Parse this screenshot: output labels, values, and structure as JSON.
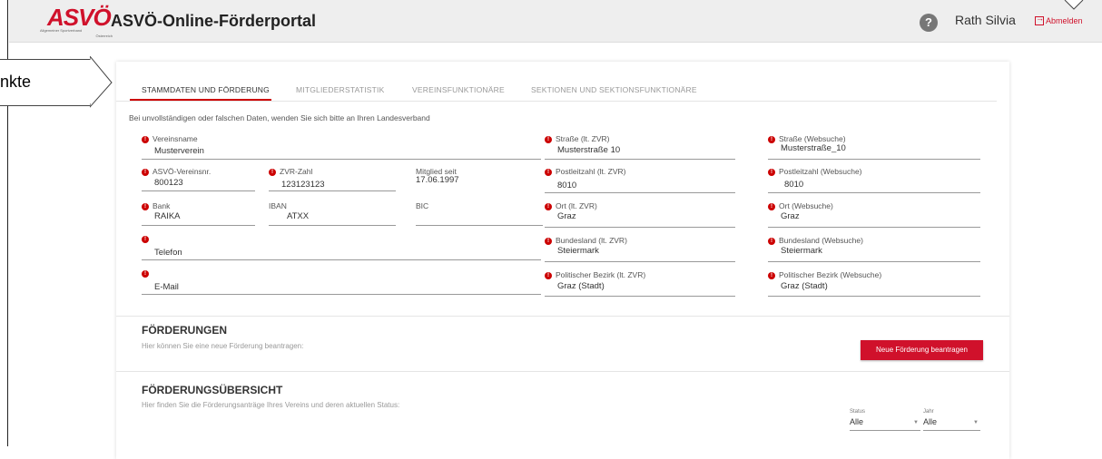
{
  "callout": {
    "text": "nkte"
  },
  "header": {
    "logo_text": "ASVÖ",
    "logo_sub": "Allgemeiner Sportverband",
    "logo_sub2": "Österreich",
    "title": "ASVÖ-Online-Förderportal",
    "help_icon": "?",
    "username": "Rath Silvia",
    "logout_label": "Abmelden"
  },
  "tabs": [
    {
      "label": "STAMMDATEN UND FÖRDERUNG",
      "active": true
    },
    {
      "label": "MITGLIEDERSTATISTIK",
      "active": false
    },
    {
      "label": "VEREINSFUNKTIONÄRE",
      "active": false
    },
    {
      "label": "SEKTIONEN UND SEKTIONSFUNKTIONÄRE",
      "active": false
    }
  ],
  "notice": "Bei unvollständigen oder falschen Daten, wenden Sie sich bitte an Ihren Landesverband",
  "fields": {
    "vereinsname": {
      "label": "Vereinsname",
      "value": "Musterverein",
      "required": true
    },
    "asvo_nr": {
      "label": "ASVÖ-Vereinsnr.",
      "value": "800123",
      "required": true
    },
    "zvr_zahl": {
      "label": "ZVR-Zahl",
      "value": "123123123",
      "required": true
    },
    "mitglied_seit": {
      "label": "Mitglied seit",
      "value": "17.06.1997",
      "required": false
    },
    "bank": {
      "label": "Bank",
      "value": "RAIKA",
      "required": true
    },
    "iban": {
      "label": "IBAN",
      "value": "ATXX",
      "required": false
    },
    "bic": {
      "label": "BIC",
      "value": "",
      "required": false
    },
    "telefon": {
      "label": "",
      "value": "Telefon",
      "required": true
    },
    "email": {
      "label": "",
      "value": "E-Mail",
      "required": true
    },
    "strasse_zvr": {
      "label": "Straße (lt. ZVR)",
      "value": "Musterstraße 10",
      "required": true
    },
    "plz_zvr": {
      "label": "Postleitzahl (lt. ZVR)",
      "value": "8010",
      "required": true
    },
    "ort_zvr": {
      "label": "Ort (lt. ZVR)",
      "value": "Graz",
      "required": true
    },
    "bundesland_zvr": {
      "label": "Bundesland (lt. ZVR)",
      "value": "Steiermark",
      "required": true
    },
    "bezirk_zvr": {
      "label": "Politischer Bezirk (lt. ZVR)",
      "value": "Graz (Stadt)",
      "required": true
    },
    "strasse_web": {
      "label": "Straße (Websuche)",
      "value": "Musterstraße_10",
      "required": true
    },
    "plz_web": {
      "label": "Postleitzahl (Websuche)",
      "value": "8010",
      "required": true
    },
    "ort_web": {
      "label": "Ort (Websuche)",
      "value": "Graz",
      "required": true
    },
    "bundesland_web": {
      "label": "Bundesland (Websuche)",
      "value": "Steiermark",
      "required": true
    },
    "bezirk_web": {
      "label": "Politischer Bezirk (Websuche)",
      "value": "Graz (Stadt)",
      "required": true
    }
  },
  "foerderungen": {
    "title": "FÖRDERUNGEN",
    "subtitle": "Hier können Sie eine neue Förderung beantragen:",
    "button": "Neue Förderung beantragen"
  },
  "uebersicht": {
    "title": "FÖRDERUNGSÜBERSICHT",
    "subtitle": "Hier finden Sie die Förderungsanträge Ihres Vereins und deren aktuellen Status:",
    "status_label": "Status",
    "status_value": "Alle",
    "jahr_label": "Jahr",
    "jahr_value": "Alle"
  },
  "colors": {
    "accent": "#d0112b",
    "topbar": "#eeeeee"
  }
}
